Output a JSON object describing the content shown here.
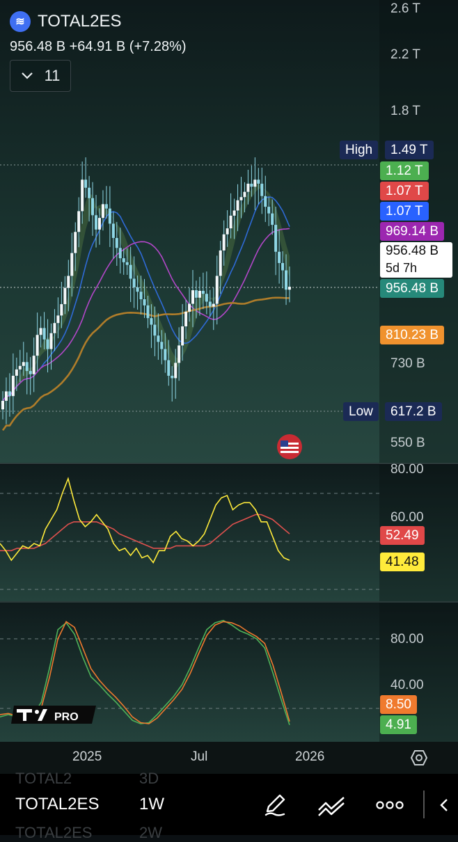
{
  "header": {
    "symbol": "TOTAL2ES",
    "price_line": "956.48 B  +64.91 B (+7.28%)",
    "dropdown_value": "11"
  },
  "axis": {
    "main_ticks": [
      "2.6 T",
      "2.2 T",
      "1.8 T",
      "730 B",
      "550 B"
    ],
    "rsi_ticks": [
      "80.00",
      "60.00"
    ],
    "stoch_ticks": [
      "80.00",
      "40.00"
    ],
    "time_ticks": [
      "2025",
      "Jul",
      "2026"
    ]
  },
  "price_labels": {
    "high_tag": "High",
    "high_value": "1.49 T",
    "low_tag": "Low",
    "low_value": "617.2 B",
    "ma1": "1.12 T",
    "ma2": "1.07 T",
    "ma3": "1.07 T",
    "ma4": "969.14 B",
    "last_price": "956.48 B",
    "countdown": "5d 7h",
    "last_value": "956.48 B",
    "ma5": "810.23 B"
  },
  "rsi_labels": {
    "rsi_ma": "52.49",
    "rsi": "41.48"
  },
  "stoch_labels": {
    "d": "8.50",
    "k": "4.91"
  },
  "colors": {
    "green_label": "#4caf50",
    "red_label": "#e04848",
    "blue_label": "#2962ff",
    "purple_label": "#9c27b0",
    "teal_label": "#26897a",
    "orange_label": "#f0922e",
    "yellow": "#ffeb3b",
    "candle": "#8fd7e6"
  },
  "bottom_bar": {
    "symbol": "TOTAL2ES",
    "timeframe": "1W",
    "ghost_top_symbol": "TOTAL2",
    "ghost_top_tf": "3D",
    "ghost_bottom_symbol": "TOTAL2ES",
    "ghost_bottom_tf": "2W",
    "icons": [
      "pencil-icon",
      "trend-lines-icon",
      "more-icon"
    ]
  },
  "badge": {
    "logo_text": "PRO"
  },
  "chart_data": [
    {
      "type": "candlestick",
      "title": "TOTAL2ES",
      "timeframe": "1W",
      "ylabel": "",
      "y_scale": "log",
      "ylim": [
        "550 B",
        "2.6 T"
      ],
      "high": "1.49 T",
      "low": "617.2 B",
      "last": "956.48 B",
      "change": "+64.91 B (+7.28%)",
      "close_billions": [
        640,
        662,
        651,
        700,
        716,
        725,
        735,
        712,
        704,
        752,
        810,
        830,
        797,
        770,
        815,
        845,
        868,
        904,
        958,
        1000,
        1085,
        1170,
        1260,
        1410,
        1370,
        1320,
        1242,
        1180,
        1230,
        1292,
        1272,
        1205,
        1145,
        1105,
        1065,
        1050,
        1040,
        990,
        960,
        945,
        920,
        900,
        860,
        840,
        808,
        790,
        770,
        740,
        700,
        694,
        733,
        780,
        835,
        880,
        905,
        950,
        925,
        948,
        938,
        912,
        896,
        905,
        1000,
        1095,
        1160,
        1185,
        1240,
        1263,
        1310,
        1325,
        1350,
        1390,
        1375,
        1410,
        1390,
        1330,
        1280,
        1250,
        1200,
        1090,
        1047,
        1020,
        952,
        962
      ],
      "overlays": [
        "MA (green)",
        "MA (red)",
        "MA (blue)",
        "MA 969.14 B (purple)",
        "MA 810.23 B (orange)"
      ]
    },
    {
      "type": "line",
      "title": "",
      "series": [
        {
          "values": [
            49,
            46,
            42,
            45,
            48,
            47,
            49,
            48,
            55,
            59,
            63,
            70,
            76,
            67,
            59,
            56,
            58,
            61,
            58,
            55,
            49,
            46,
            47,
            44,
            47,
            43,
            44,
            41,
            46,
            46,
            52,
            54,
            51,
            50,
            48,
            50,
            53,
            59,
            65,
            68,
            69,
            63,
            65,
            66,
            66,
            63,
            58,
            58,
            52,
            46,
            43,
            42
          ]
        },
        {
          "values": [
            46,
            46,
            46,
            47,
            47,
            47,
            47,
            48,
            49,
            51,
            53,
            55,
            57,
            58,
            58,
            58,
            58,
            58,
            57,
            56,
            55,
            53,
            52,
            51,
            50,
            49,
            48,
            47,
            47,
            47,
            47,
            48,
            48,
            48,
            48,
            48,
            48,
            49,
            51,
            53,
            55,
            57,
            58,
            59,
            60,
            61,
            61,
            60,
            59,
            57,
            55,
            53
          ]
        }
      ],
      "labels": [
        "52.49",
        "41.48"
      ],
      "ylim": [
        30,
        80
      ]
    },
    {
      "type": "line",
      "title": "",
      "series": [
        {
          "values": [
            12,
            14,
            12,
            10,
            13,
            25,
            55,
            88,
            94,
            84,
            64,
            47,
            40,
            32,
            25,
            17,
            9,
            6,
            7,
            14,
            22,
            30,
            40,
            55,
            72,
            88,
            94,
            96,
            92,
            87,
            84,
            80,
            72,
            50,
            27,
            5
          ]
        },
        {
          "values": [
            14,
            15,
            13,
            12,
            13,
            20,
            47,
            80,
            95,
            90,
            72,
            54,
            44,
            36,
            29,
            21,
            12,
            7,
            6,
            11,
            19,
            27,
            36,
            50,
            67,
            83,
            92,
            95,
            94,
            91,
            86,
            82,
            76,
            57,
            33,
            8
          ]
        }
      ],
      "labels": [
        "8.50",
        "4.91"
      ],
      "ylim": [
        0,
        100
      ]
    }
  ]
}
